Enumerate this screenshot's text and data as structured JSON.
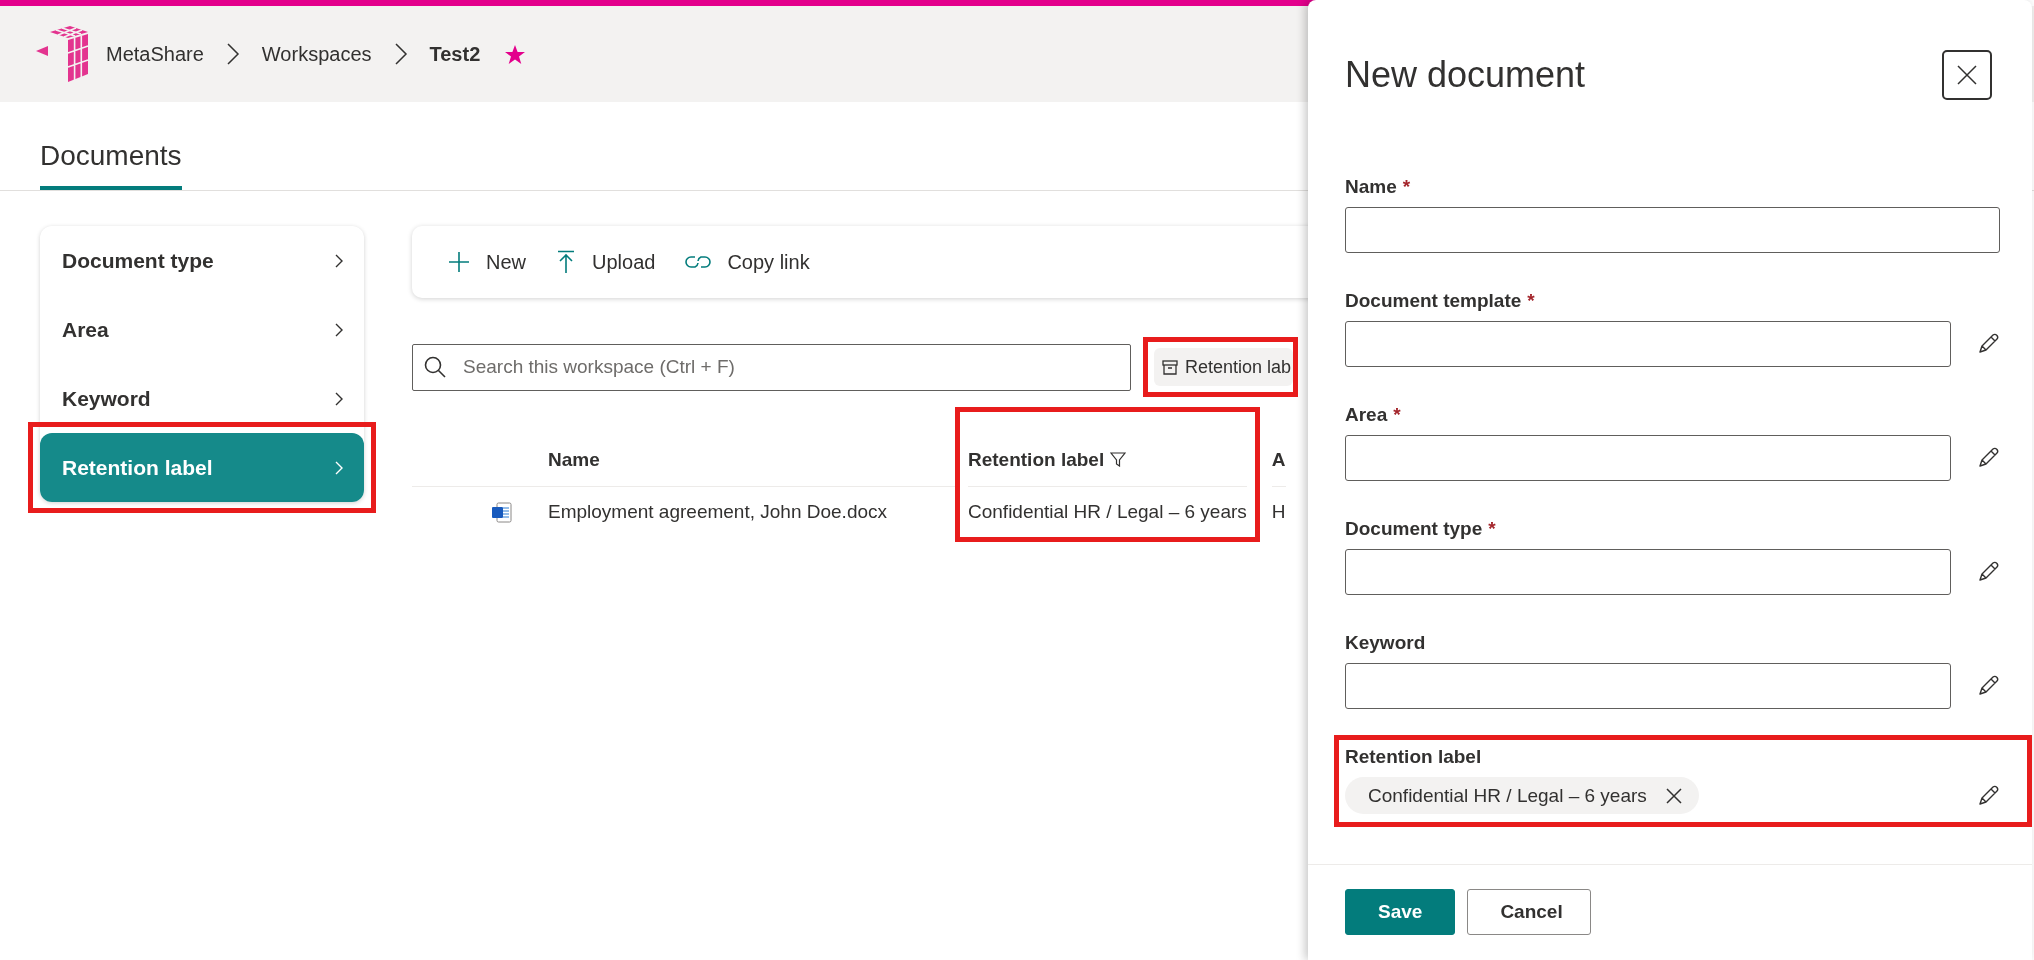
{
  "breadcrumb": [
    {
      "label": "MetaShare",
      "current": false
    },
    {
      "label": "Workspaces",
      "current": false
    },
    {
      "label": "Test2",
      "current": true
    }
  ],
  "favorite": true,
  "tabs": [
    {
      "label": "Documents",
      "selected": true
    }
  ],
  "filter_nav": [
    {
      "label": "Document type",
      "selected": false,
      "highlighted": false
    },
    {
      "label": "Area",
      "selected": false,
      "highlighted": false
    },
    {
      "label": "Keyword",
      "selected": false,
      "highlighted": false
    },
    {
      "label": "Retention label",
      "selected": true,
      "highlighted": true
    }
  ],
  "toolbar": [
    {
      "label": "New",
      "kind": "new"
    },
    {
      "label": "Upload",
      "kind": "upload"
    },
    {
      "label": "Copy link",
      "kind": "link"
    }
  ],
  "search": {
    "placeholder": "Search this workspace (Ctrl + F)"
  },
  "filter_chip": {
    "label": "Retention lab",
    "highlighted": true
  },
  "table": {
    "columns": [
      {
        "label": "Name",
        "filtered": false,
        "highlighted": false
      },
      {
        "label": "Retention label",
        "filtered": true,
        "highlighted": true
      },
      {
        "label": "A",
        "filtered": false,
        "highlighted": false
      }
    ],
    "rows": [
      {
        "kind": "word",
        "cells": [
          "Employment agreement, John Doe.docx",
          "Confidential HR / Legal – 6 years",
          "H"
        ]
      }
    ]
  },
  "panel": {
    "title": "New document",
    "fields": [
      {
        "label": "Name",
        "required_mark": "*",
        "kind": "text",
        "editable": false,
        "highlighted": false
      },
      {
        "label": "Document template",
        "required_mark": "*",
        "kind": "text",
        "editable": true,
        "highlighted": false
      },
      {
        "label": "Area",
        "required_mark": "*",
        "kind": "text",
        "editable": true,
        "highlighted": false
      },
      {
        "label": "Document type",
        "required_mark": "*",
        "kind": "text",
        "editable": true,
        "highlighted": false
      },
      {
        "label": "Keyword",
        "kind": "text",
        "editable": true,
        "highlighted": false
      },
      {
        "label": "Retention label",
        "kind": "tags",
        "tags": [
          "Confidential HR / Legal – 6 years"
        ],
        "editable": true,
        "highlighted": true
      }
    ],
    "buttons": [
      {
        "label": "Save",
        "primary": true
      },
      {
        "label": "Cancel",
        "primary": false
      }
    ]
  }
}
